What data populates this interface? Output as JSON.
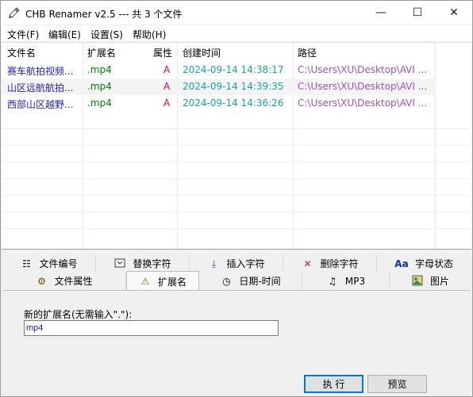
{
  "window": {
    "title": "CHB Renamer v2.5 --- 共 3 个文件",
    "minimize": "—",
    "maximize": "☐",
    "close": "✕"
  },
  "menu": [
    "文件(F)",
    "编辑(E)",
    "设置(S)",
    "帮助(H)"
  ],
  "table": {
    "columns": [
      "文件名",
      "扩展名",
      "属性",
      "创建时间",
      "路径"
    ],
    "rows": [
      {
        "name": "赛车航拍视频...",
        "ext": ".mp4",
        "attr": "A",
        "created": "2024-09-14 14:38:17",
        "path": "C:\\Users\\XU\\Desktop\\AVI ..."
      },
      {
        "name": "山区远航航拍...",
        "ext": ".mp4",
        "attr": "A",
        "created": "2024-09-14 14:39:35",
        "path": "C:\\Users\\XU\\Desktop\\AVI ..."
      },
      {
        "name": "西部山区越野...",
        "ext": ".mp4",
        "attr": "A",
        "created": "2024-09-14 14:36:26",
        "path": "C:\\Users\\XU\\Desktop\\AVI ..."
      }
    ]
  },
  "tabs_row1": [
    "文件编号",
    "替换字符",
    "插入字符",
    "删除字符",
    "字母状态"
  ],
  "tabs_row2": [
    "文件属性",
    "扩展名",
    "日期-时间",
    "MP3",
    "图片"
  ],
  "active_tab": "扩展名",
  "panel": {
    "label": "新的扩展名(无需输入\".\"):",
    "value": "mp4"
  },
  "buttons": {
    "execute": "执 行",
    "preview": "预览"
  },
  "colors": {
    "name": "#2020c0",
    "ext": "#008000",
    "attr": "#e0005a",
    "created": "#1aa0a8",
    "path": "#a050c0"
  }
}
